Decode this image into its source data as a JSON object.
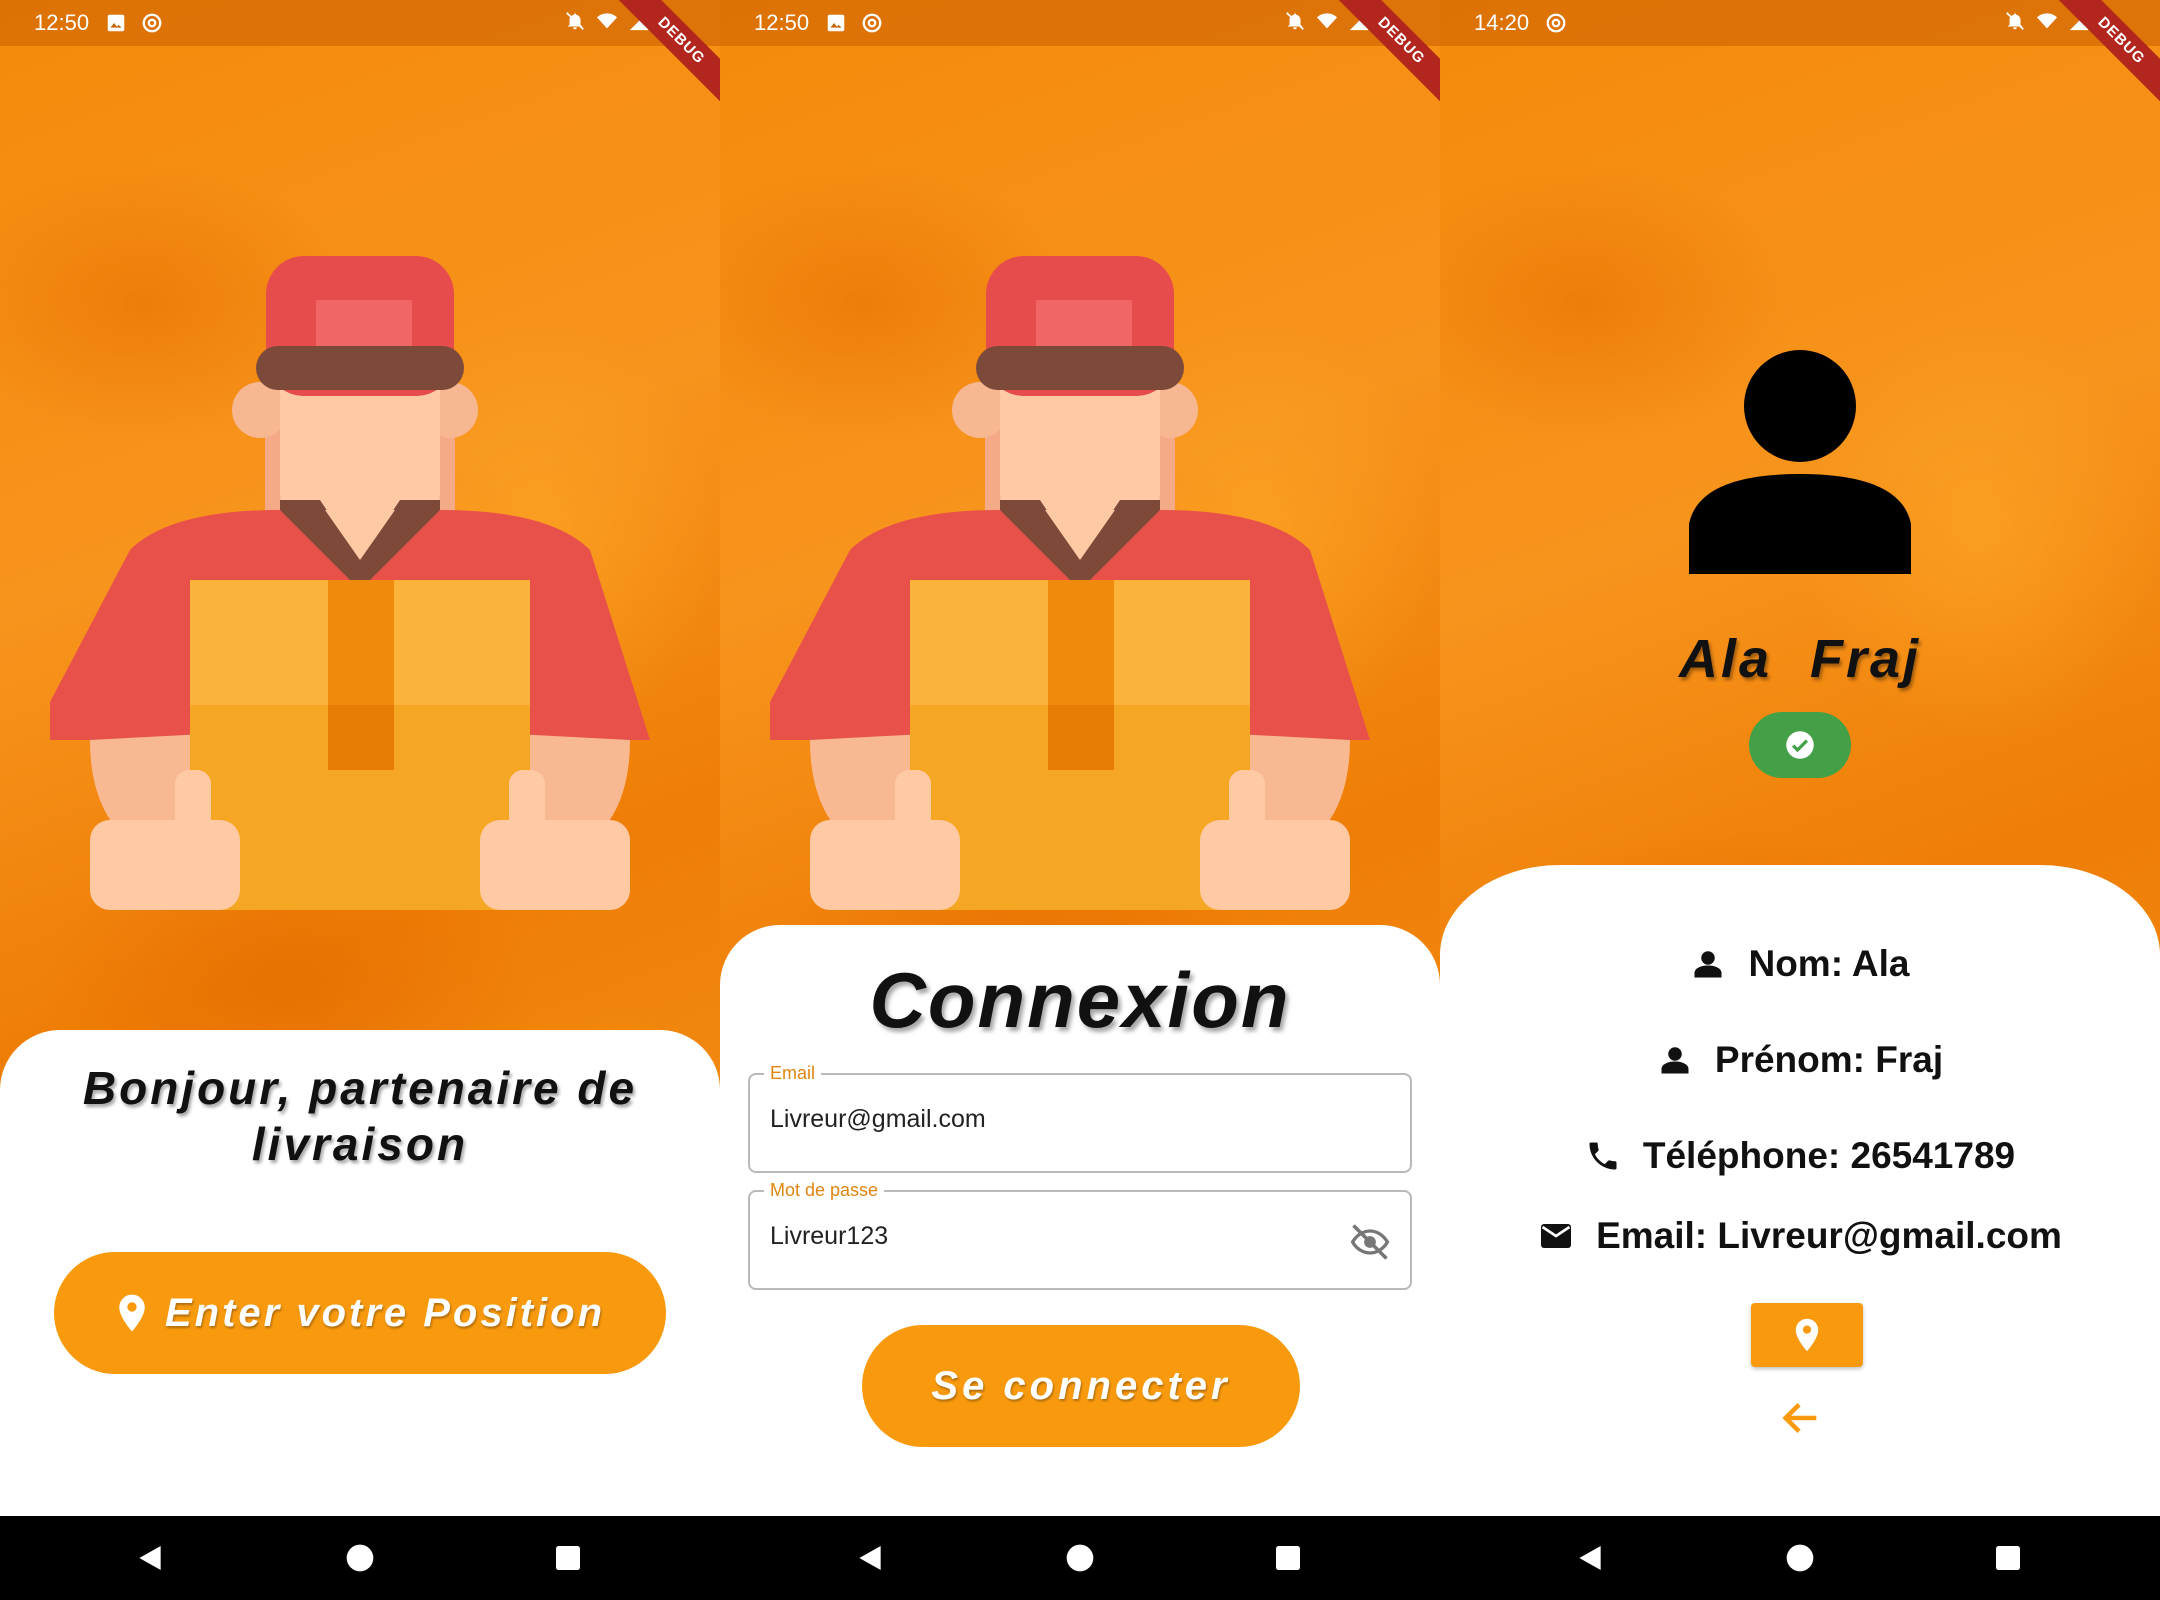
{
  "screens": [
    {
      "status": {
        "time": "12:50"
      },
      "debug_label": "DEBUG",
      "welcome_title": "Bonjour, partenaire de livraison",
      "position_button_label": "Enter votre Position"
    },
    {
      "status": {
        "time": "12:50"
      },
      "debug_label": "DEBUG",
      "login": {
        "title": "Connexion",
        "email_label": "Email",
        "email_value": "Livreur@gmail.com",
        "password_label": "Mot de passe",
        "password_value": "Livreur123",
        "submit_label": "Se connecter"
      }
    },
    {
      "status": {
        "time": "14:20"
      },
      "debug_label": "DEBUG",
      "profile": {
        "name": "Ala  Fraj",
        "nom": "Nom: Ala",
        "prenom": "Prénom: Fraj",
        "telephone": "Téléphone: 26541789",
        "email": "Email: Livreur@gmail.com"
      }
    }
  ],
  "icons": {
    "location": "location-pin-icon",
    "eye_off": "visibility-off-icon",
    "person": "person-icon",
    "phone": "phone-icon",
    "mail": "mail-icon",
    "check": "check-circle-icon",
    "back": "arrow-back-icon"
  },
  "colors": {
    "accent": "#f99a0e",
    "verified": "#43a047",
    "debug": "#b3261e",
    "field_label": "#e08510"
  }
}
